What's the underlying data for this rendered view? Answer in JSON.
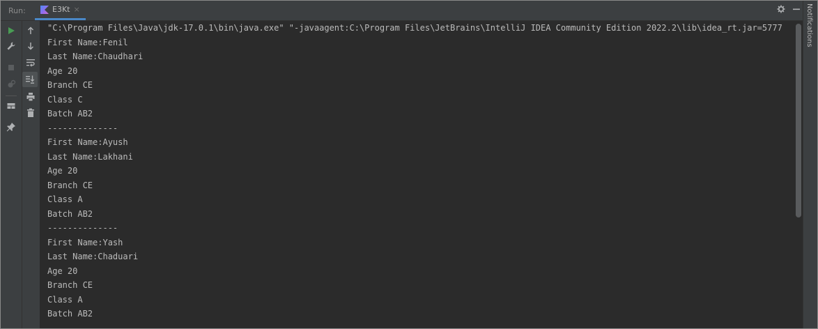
{
  "header": {
    "run_label": "Run:",
    "tab_label": "E3Kt",
    "tab_close": "×",
    "settings_glyph": "✿",
    "minimize_glyph": "—"
  },
  "right_strip": {
    "notifications_label": "Notifications"
  },
  "toolbar": {
    "left_icons": [
      "run-icon",
      "wrench-icon",
      "stop-icon",
      "debug-icon",
      "layout-icon",
      "pin-icon"
    ],
    "right_icons": [
      "scroll-up-icon",
      "scroll-down-icon",
      "soft-wrap-icon",
      "scroll-to-end-icon",
      "print-icon",
      "trash-icon"
    ]
  },
  "console": {
    "lines": [
      "\"C:\\Program Files\\Java\\jdk-17.0.1\\bin\\java.exe\" \"-javaagent:C:\\Program Files\\JetBrains\\IntelliJ IDEA Community Edition 2022.2\\lib\\idea_rt.jar=5777",
      "First Name:Fenil",
      "Last Name:Chaudhari",
      "Age 20",
      "Branch CE",
      "Class C",
      "Batch AB2",
      "--------------",
      "First Name:Ayush",
      "Last Name:Lakhani",
      "Age 20",
      "Branch CE",
      "Class A",
      "Batch AB2",
      "--------------",
      "First Name:Yash",
      "Last Name:Chaduari",
      "Age 20",
      "Branch CE",
      "Class A",
      "Batch AB2",
      "--------------"
    ]
  },
  "colors": {
    "background": "#2b2b2b",
    "panel": "#3c3f41",
    "text": "#bbbbbb",
    "run_green": "#499c54",
    "accent_blue": "#4a88c7"
  }
}
